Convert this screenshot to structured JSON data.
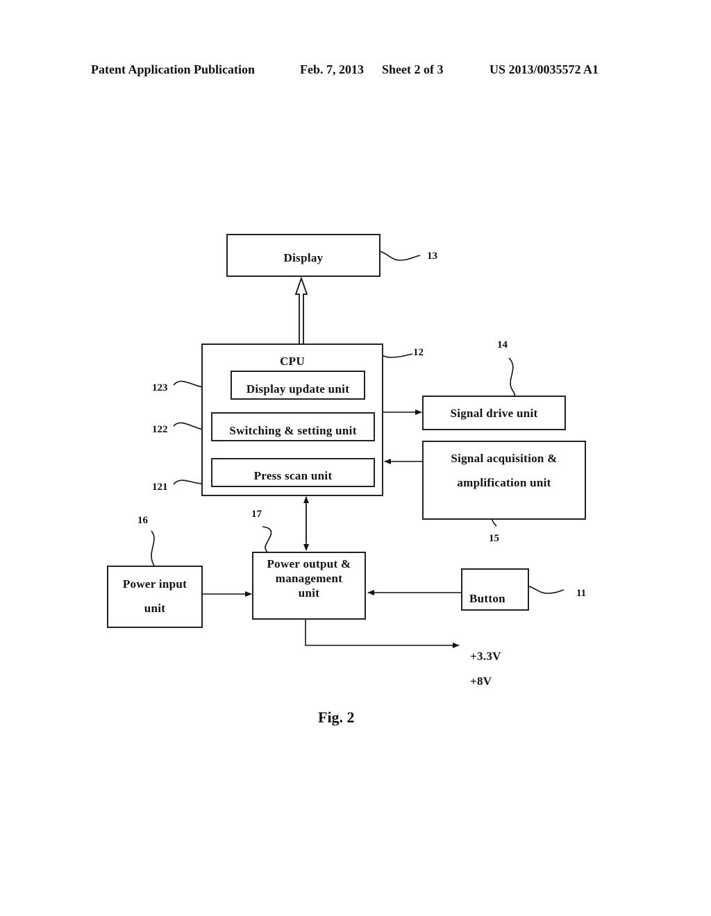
{
  "header": {
    "publication": "Patent Application Publication",
    "date": "Feb. 7, 2013",
    "sheet": "Sheet 2 of 3",
    "number": "US 2013/0035572 A1"
  },
  "blocks": {
    "display": {
      "label": "Display",
      "ref": "13"
    },
    "cpu": {
      "label": "CPU",
      "ref": "12"
    },
    "display_update": {
      "label": "Display update unit",
      "ref": "123"
    },
    "switching": {
      "label": "Switching & setting unit",
      "ref": "122"
    },
    "press_scan": {
      "label": "Press scan unit",
      "ref": "121"
    },
    "signal_drive": {
      "label": "Signal drive unit",
      "ref": "14"
    },
    "signal_acq": {
      "line1": "Signal acquisition &",
      "line2": "amplification unit",
      "ref": "15"
    },
    "power_input": {
      "line1": "Power input",
      "line2": "unit",
      "ref": "16"
    },
    "power_output": {
      "line1": "Power output &",
      "line2": "management",
      "line3": "unit",
      "ref": "17"
    },
    "button": {
      "label": "Button",
      "ref": "11"
    }
  },
  "outputs": {
    "v1": "+3.3V",
    "v2": "+8V"
  },
  "figure_label": "Fig. 2"
}
